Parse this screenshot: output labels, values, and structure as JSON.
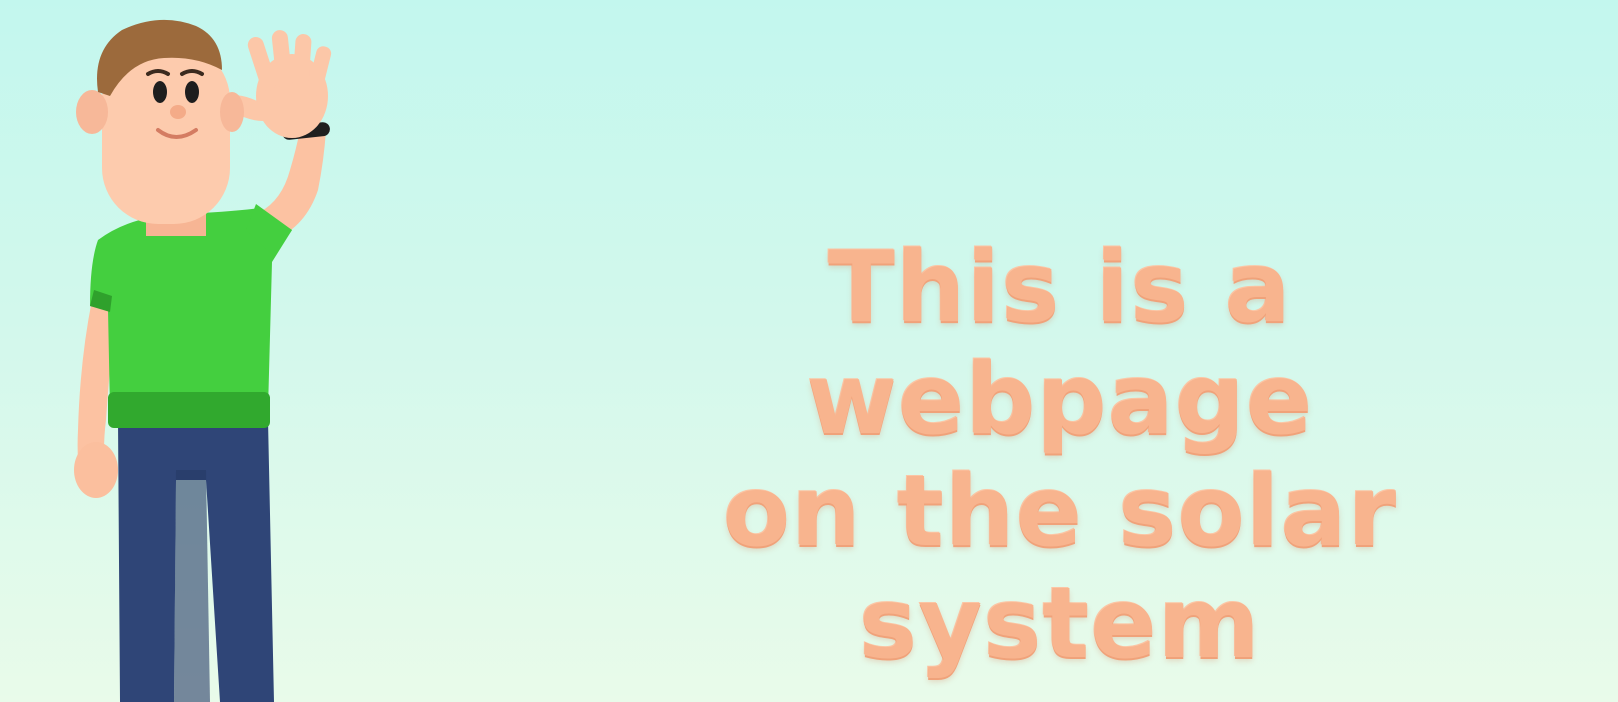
{
  "headline": {
    "lines": [
      "This is a webpage",
      "on the solar",
      "system"
    ]
  },
  "colors": {
    "background_top": "#c3f7ee",
    "background_bottom": "#e9fbea",
    "headline_text": "#f8b48e",
    "shirt": "#3fcc3c",
    "pants": "#2f4577",
    "skin": "#fcc7a8",
    "hair": "#9c6a3c"
  },
  "illustration": {
    "icon": "waving-cartoon-man"
  }
}
